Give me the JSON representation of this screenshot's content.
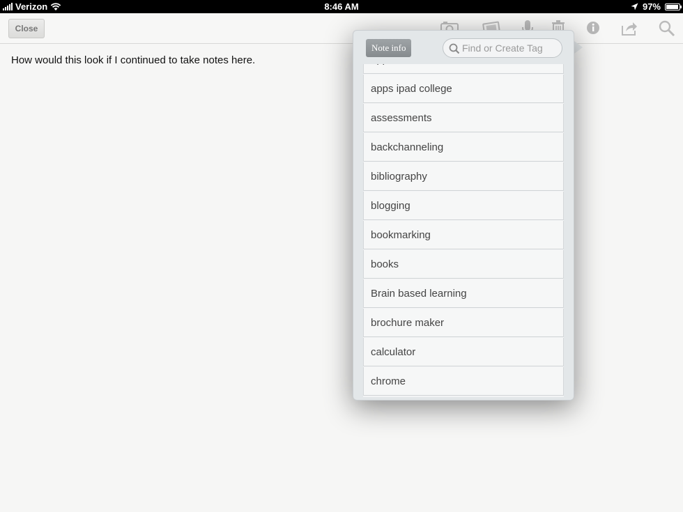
{
  "status_bar": {
    "carrier": "Verizon",
    "time": "8:46 AM",
    "battery": "97%",
    "battery_level": 0.97
  },
  "toolbar": {
    "close_label": "Close",
    "icons": [
      "camera-icon",
      "snapshot-icon",
      "microphone-icon",
      "trash-icon",
      "info-icon",
      "share-icon",
      "search-icon"
    ]
  },
  "note": {
    "text": "How would this look if I continued to take notes here."
  },
  "popover": {
    "back_label": "Note info",
    "search_placeholder": "Find or Create Tag",
    "tags": [
      "apps for education",
      "apps ipad college",
      "assessments",
      "backchanneling",
      "bibliography",
      "blogging",
      "bookmarking",
      "books",
      "Brain based learning",
      "brochure maker",
      "calculator",
      "chrome"
    ]
  }
}
